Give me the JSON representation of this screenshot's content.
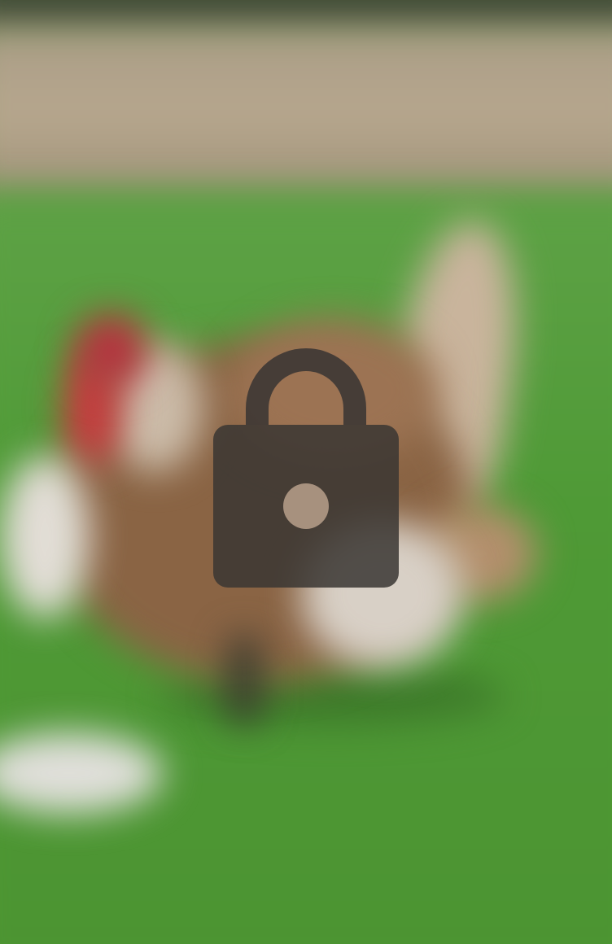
{
  "screen": {
    "background_description_color": "#5c9a3c",
    "overlay_icon": "lock-icon",
    "overlay_color": "#3a3633",
    "overlay_opacity": 0.85,
    "keyhole_color": "#b19a86"
  }
}
